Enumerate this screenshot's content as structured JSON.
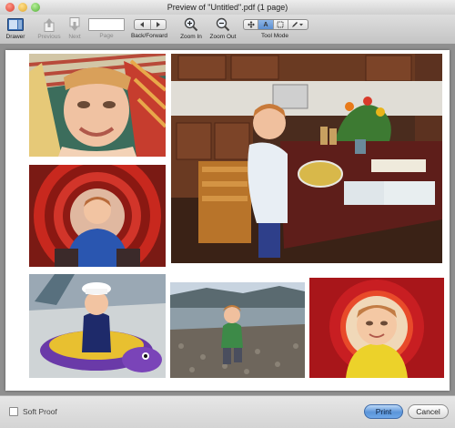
{
  "window": {
    "title": "Preview of \"Untitled\".pdf (1 page)"
  },
  "toolbar": {
    "drawer_label": "Drawer",
    "previous_label": "Previous",
    "next_label": "Next",
    "page_label": "Page",
    "page_value": "",
    "back_forward_label": "Back/Forward",
    "zoom_in_label": "Zoom In",
    "zoom_out_label": "Zoom Out",
    "tool_mode_label": "Tool Mode",
    "tool_mode_options": [
      "move-icon",
      "text-select-icon",
      "select-rect-icon",
      "annotate-icon"
    ],
    "tool_mode_text_glyph": "A",
    "selected_tool_mode": "text-select-icon"
  },
  "photos": [
    {
      "name": "photo-boy-striped-hat",
      "subject": "toddler in striped knit hat"
    },
    {
      "name": "photo-boy-kitchen",
      "subject": "toddler mixing bowl in kitchen"
    },
    {
      "name": "photo-boy-red-tunnel",
      "subject": "toddler in red play tunnel"
    },
    {
      "name": "photo-boy-sandbox-turtle",
      "subject": "toddler on turtle sandbox"
    },
    {
      "name": "photo-boy-beach",
      "subject": "toddler on pebble beach"
    },
    {
      "name": "photo-boy-porthole",
      "subject": "toddler in red porthole"
    }
  ],
  "footer": {
    "soft_proof_label": "Soft Proof",
    "soft_proof_checked": false,
    "print_label": "Print",
    "cancel_label": "Cancel"
  },
  "colors": {
    "accent": "#5b95d9",
    "print_button_border": "#3d6aa8"
  }
}
